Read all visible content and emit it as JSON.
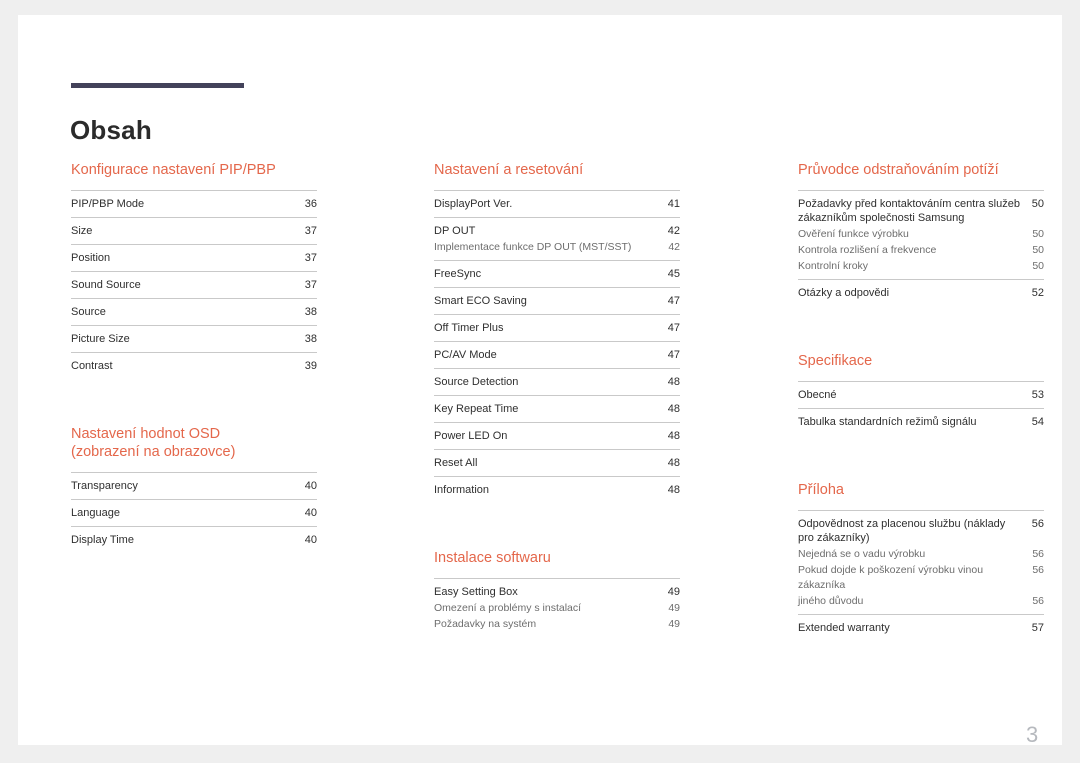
{
  "document": {
    "title": "Obsah",
    "folio": "3",
    "accent_color": "#e4674b",
    "rule_color": "#43425a"
  },
  "columns": [
    {
      "sections": [
        {
          "heading": "Konfigurace nastavení PIP/PBP",
          "entries": [
            {
              "label": "PIP/PBP Mode",
              "page": "36",
              "subs": []
            },
            {
              "label": "Size",
              "page": "37",
              "subs": []
            },
            {
              "label": "Position",
              "page": "37",
              "subs": []
            },
            {
              "label": "Sound Source",
              "page": "37",
              "subs": []
            },
            {
              "label": "Source",
              "page": "38",
              "subs": []
            },
            {
              "label": "Picture Size",
              "page": "38",
              "subs": []
            },
            {
              "label": "Contrast",
              "page": "39",
              "subs": []
            }
          ]
        },
        {
          "heading": "Nastavení hodnot OSD\n(zobrazení na obrazovce)",
          "entries": [
            {
              "label": "Transparency",
              "page": "40",
              "subs": []
            },
            {
              "label": "Language",
              "page": "40",
              "subs": []
            },
            {
              "label": "Display Time",
              "page": "40",
              "subs": []
            }
          ]
        }
      ]
    },
    {
      "sections": [
        {
          "heading": "Nastavení a resetování",
          "entries": [
            {
              "label": "DisplayPort Ver.",
              "page": "41",
              "subs": []
            },
            {
              "label": "DP OUT",
              "page": "42",
              "subs": [
                {
                  "label": "Implementace funkce DP OUT (MST/SST)",
                  "page": "42"
                }
              ]
            },
            {
              "label": "FreeSync",
              "page": "45",
              "subs": []
            },
            {
              "label": "Smart ECO Saving",
              "page": "47",
              "subs": []
            },
            {
              "label": "Off Timer Plus",
              "page": "47",
              "subs": []
            },
            {
              "label": "PC/AV Mode",
              "page": "47",
              "subs": []
            },
            {
              "label": "Source Detection",
              "page": "48",
              "subs": []
            },
            {
              "label": "Key Repeat Time",
              "page": "48",
              "subs": []
            },
            {
              "label": "Power LED On",
              "page": "48",
              "subs": []
            },
            {
              "label": "Reset All",
              "page": "48",
              "subs": []
            },
            {
              "label": "Information",
              "page": "48",
              "subs": []
            }
          ]
        },
        {
          "heading": "Instalace softwaru",
          "entries": [
            {
              "label": "Easy Setting Box",
              "page": "49",
              "subs": [
                {
                  "label": "Omezení a problémy s instalací",
                  "page": "49"
                },
                {
                  "label": "Požadavky na systém",
                  "page": "49"
                }
              ]
            }
          ]
        }
      ]
    },
    {
      "sections": [
        {
          "heading": "Průvodce odstraňováním potíží",
          "entries": [
            {
              "label": "Požadavky před kontaktováním centra služeb zákazníkům společnosti Samsung",
              "page": "50",
              "subs": [
                {
                  "label": "Ověření funkce výrobku",
                  "page": "50"
                },
                {
                  "label": "Kontrola rozlišení a frekvence",
                  "page": "50"
                },
                {
                  "label": "Kontrolní kroky",
                  "page": "50"
                }
              ]
            },
            {
              "label": "Otázky a odpovědi",
              "page": "52",
              "subs": []
            }
          ]
        },
        {
          "heading": "Specifikace",
          "entries": [
            {
              "label": "Obecné",
              "page": "53",
              "subs": []
            },
            {
              "label": "Tabulka standardních režimů signálu",
              "page": "54",
              "subs": []
            }
          ]
        },
        {
          "heading": "Příloha",
          "entries": [
            {
              "label": "Odpovědnost za placenou službu (náklady pro zákazníky)",
              "page": "56",
              "subs": [
                {
                  "label": "Nejedná se o vadu výrobku",
                  "page": "56"
                },
                {
                  "label": "Pokud dojde k poškození výrobku vinou zákazníka",
                  "page": "56"
                },
                {
                  "label": "jiného důvodu",
                  "page": "56"
                }
              ]
            },
            {
              "label": "Extended warranty",
              "page": "57",
              "subs": []
            }
          ]
        }
      ]
    }
  ]
}
